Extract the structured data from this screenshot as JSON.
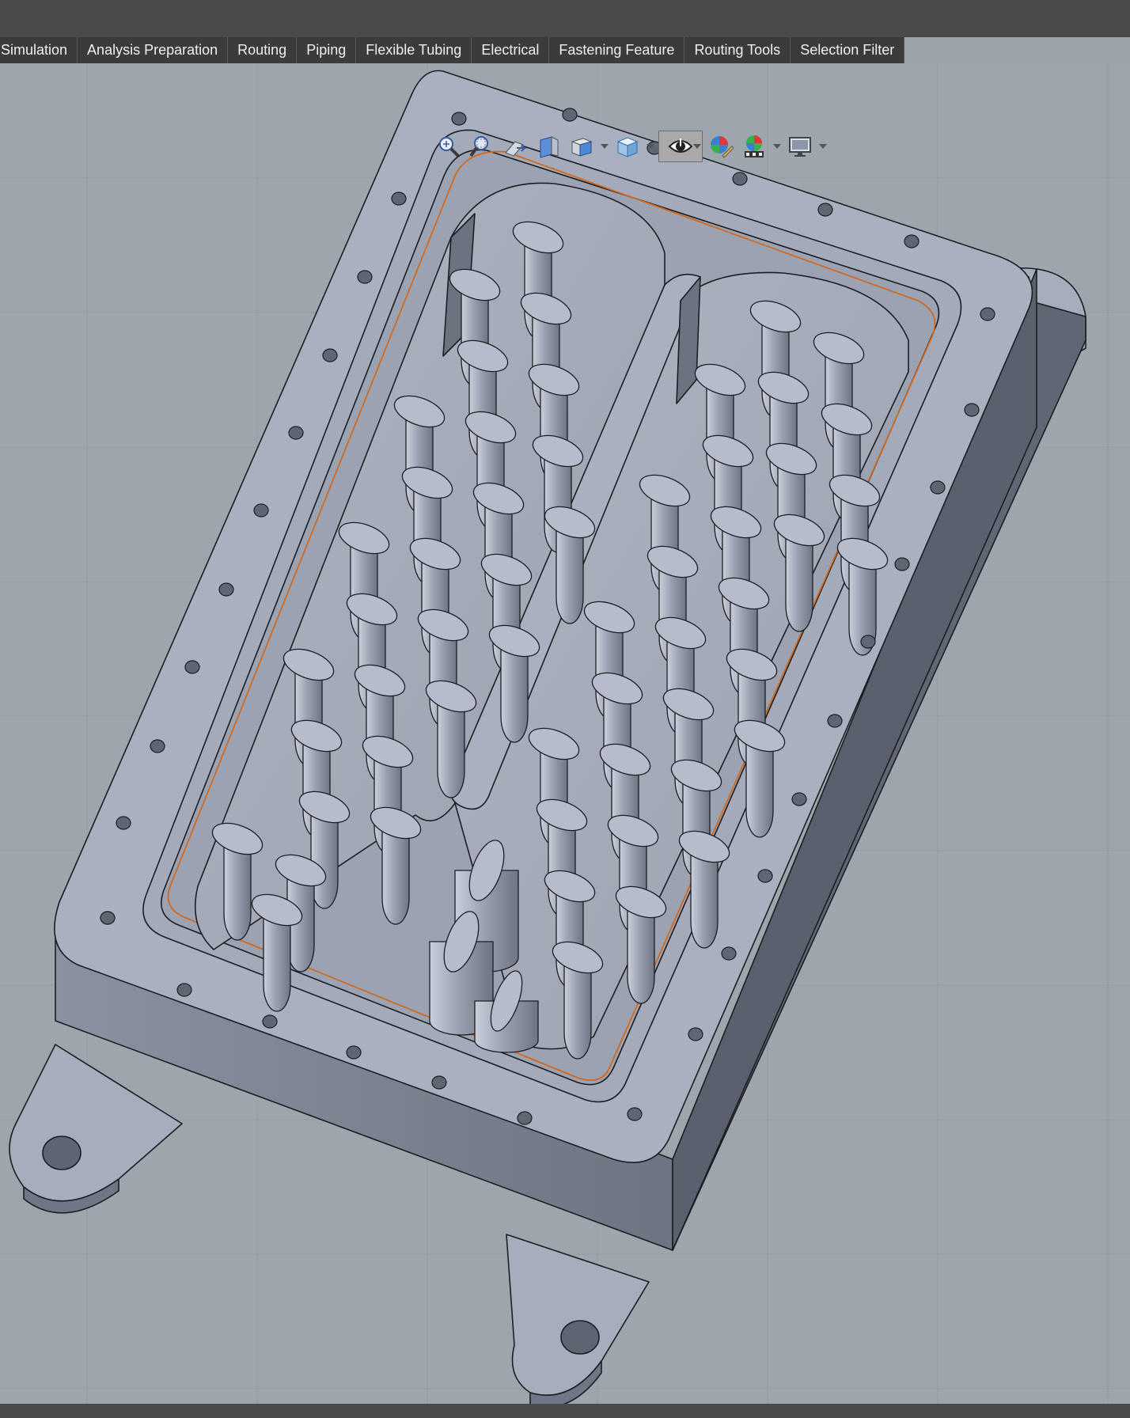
{
  "menu": {
    "tabs": [
      {
        "label": "Simulation"
      },
      {
        "label": "Analysis Preparation"
      },
      {
        "label": "Routing"
      },
      {
        "label": "Piping"
      },
      {
        "label": "Flexible Tubing"
      },
      {
        "label": "Electrical"
      },
      {
        "label": "Fastening Feature"
      },
      {
        "label": "Routing Tools"
      },
      {
        "label": "Selection Filter"
      }
    ]
  },
  "view_toolbar": {
    "icons": [
      "zoom-to-fit-icon",
      "zoom-to-area-icon",
      "previous-view-icon",
      "section-view-icon",
      "view-orientation-icon",
      "display-style-icon",
      "hide-show-items-icon",
      "edit-appearance-icon",
      "apply-scene-icon",
      "view-settings-icon"
    ]
  },
  "colors": {
    "titlebar": "#4a4a4a",
    "tabbar": "#3b3b3b",
    "viewport_bg": "#9da5ad",
    "part_face": "#a9b0c0",
    "part_shadow": "#7a8190",
    "edge": "#1e1e22",
    "selection_edge": "#d2691e"
  }
}
